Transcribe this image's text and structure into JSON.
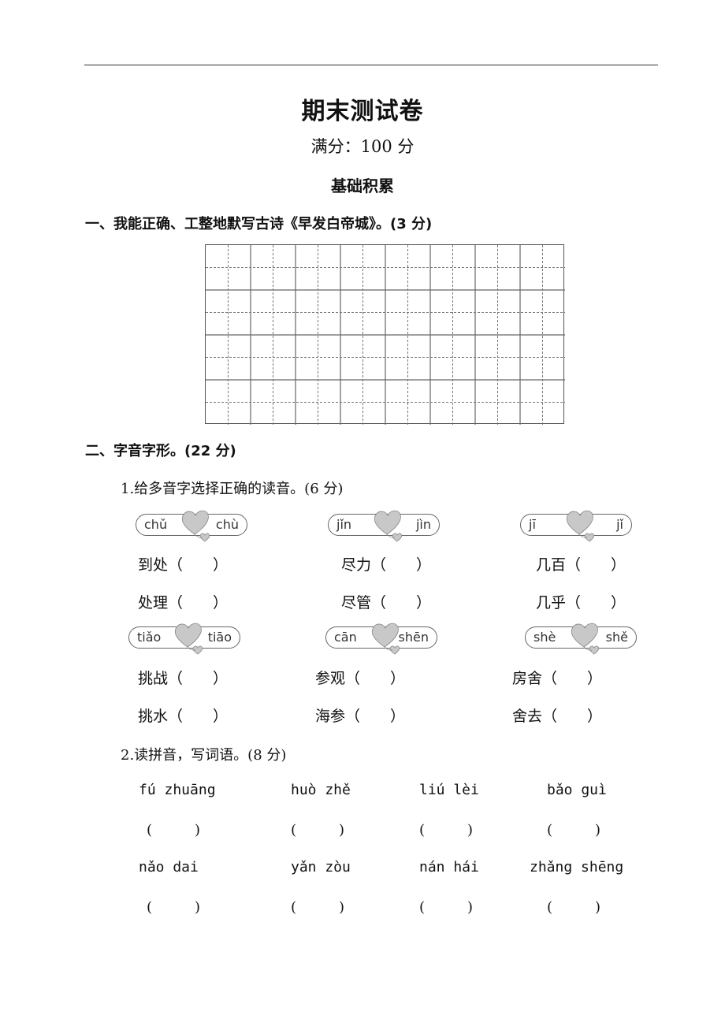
{
  "header": {
    "title": "期末测试卷",
    "full_score": "满分：100 分",
    "section": "基础积累"
  },
  "q1": {
    "heading": "一、我能正确、工整地默写古诗《早发白帝城》。(3 分)",
    "grid": {
      "rows": 4,
      "cols": 8,
      "style": "tianzige"
    }
  },
  "q2": {
    "heading": "二、字音字形。(22 分)",
    "part1": {
      "heading": "1.给多音字选择正确的读音。(6 分)",
      "groups": [
        {
          "options": [
            "chǔ",
            "chù"
          ],
          "words": [
            "到处（　　）",
            "处理（　　）"
          ]
        },
        {
          "options": [
            "jǐn",
            "jìn"
          ],
          "words": [
            "尽力（　　）",
            "尽管（　　）"
          ]
        },
        {
          "options": [
            "jī",
            "jǐ"
          ],
          "words": [
            "几百（　　）",
            "几乎（　　）"
          ]
        },
        {
          "options": [
            "tiǎo",
            "tiāo"
          ],
          "words": [
            "挑战（　　）",
            "挑水（　　）"
          ]
        },
        {
          "options": [
            "cān",
            "shēn"
          ],
          "words": [
            "参观（　　）",
            "海参（　　）"
          ]
        },
        {
          "options": [
            "shè",
            "shě"
          ],
          "words": [
            "房舍（　　）",
            "舍去（　　）"
          ]
        }
      ]
    },
    "part2": {
      "heading": "2.读拼音，写词语。(8 分)",
      "items": [
        {
          "pinyin": "fú zhuāng",
          "blank": "(　　　)"
        },
        {
          "pinyin": "huò zhě",
          "blank": "(　　　)"
        },
        {
          "pinyin": "liú lèi",
          "blank": "(　　　)"
        },
        {
          "pinyin": "bǎo guì",
          "blank": "(　　　)"
        },
        {
          "pinyin": "nǎo dai",
          "blank": "(　　　)"
        },
        {
          "pinyin": "yǎn zòu",
          "blank": "(　　　)"
        },
        {
          "pinyin": "nán hái",
          "blank": "(　　　)"
        },
        {
          "pinyin": "zhǎng shēng",
          "blank": "(　　　)"
        }
      ]
    }
  },
  "colors": {
    "heart": "#c8c8c8",
    "rule": "#333333"
  }
}
